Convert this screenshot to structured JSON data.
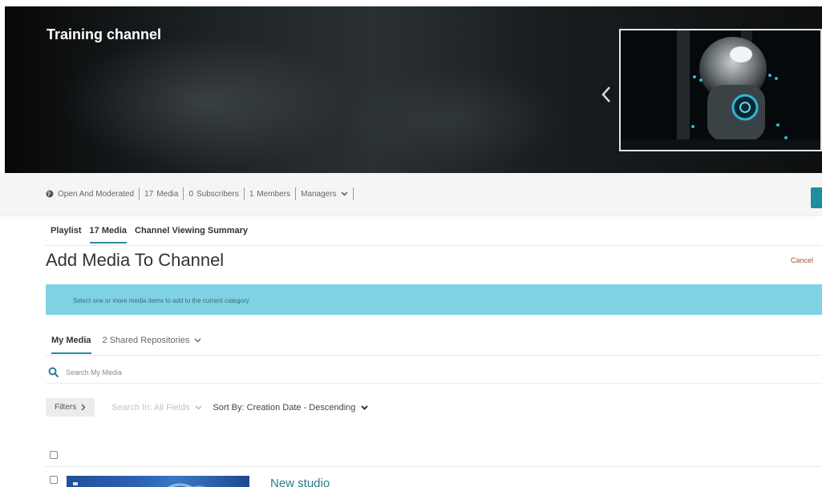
{
  "channel": {
    "title": "Training channel"
  },
  "info": {
    "privacy": "Open And Moderated",
    "media_count": "17",
    "media_label": "Media",
    "subscribers_count": "0",
    "subscribers_label": "Subscribers",
    "members_count": "1",
    "members_label": "Members",
    "managers_label": "Managers"
  },
  "tabs": [
    {
      "label": "Playlist"
    },
    {
      "label": "17 Media"
    },
    {
      "label": "Channel Viewing Summary"
    }
  ],
  "page": {
    "title": "Add Media To Channel",
    "cancel": "Cancel",
    "alert": "Select one or more media items to add to the current category"
  },
  "media_tabs": {
    "my_media": "My Media",
    "shared": "2 Shared Repositories"
  },
  "search": {
    "placeholder": "Search My Media"
  },
  "filters": {
    "button": "Filters",
    "search_in": "Search In: All Fields",
    "sort_by": "Sort By: Creation Date - Descending"
  },
  "media_items": [
    {
      "title": "New studio"
    }
  ],
  "colors": {
    "accent": "#2a8a9b",
    "alert_bg": "#7fd2e3",
    "cancel": "#a0522d"
  },
  "icons": {
    "carousel_prev": "chevron-left-icon",
    "privacy": "globe-icon",
    "managers_dropdown": "chevron-down-icon",
    "search": "search-icon",
    "filters": "chevron-right-icon"
  }
}
